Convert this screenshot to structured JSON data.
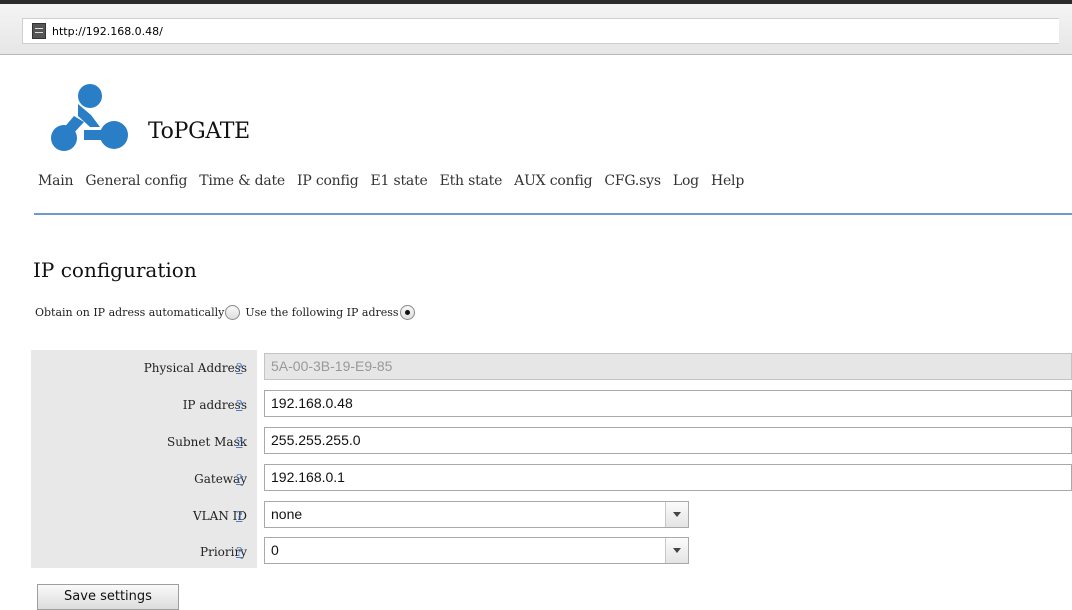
{
  "browser": {
    "url": "http://192.168.0.48/"
  },
  "brand": {
    "name": "ToPGATE",
    "color": "#2a7ec6"
  },
  "nav": {
    "items": [
      "Main",
      "General config",
      "Time & date",
      "IP config",
      "E1 state",
      "Eth state",
      "AUX config",
      "CFG.sys",
      "Log",
      "Help"
    ]
  },
  "page": {
    "title": "IP configuration",
    "mode": {
      "auto_label": "Obtain on IP adress automatically",
      "auto_selected": false,
      "manual_label": "Use the following IP adress",
      "manual_selected": true
    }
  },
  "form": {
    "help": "?",
    "physical_address": {
      "label": "Physical Address",
      "value": "5A-00-3B-19-E9-85"
    },
    "ip_address": {
      "label": "IP address",
      "value": "192.168.0.48"
    },
    "subnet_mask": {
      "label": "Subnet Mask",
      "value": "255.255.255.0"
    },
    "gateway": {
      "label": "Gateway",
      "value": "192.168.0.1"
    },
    "vlan_id": {
      "label": "VLAN ID",
      "value": "none"
    },
    "priority": {
      "label": "Prioriry",
      "value": "0"
    },
    "save_label": "Save settings"
  }
}
